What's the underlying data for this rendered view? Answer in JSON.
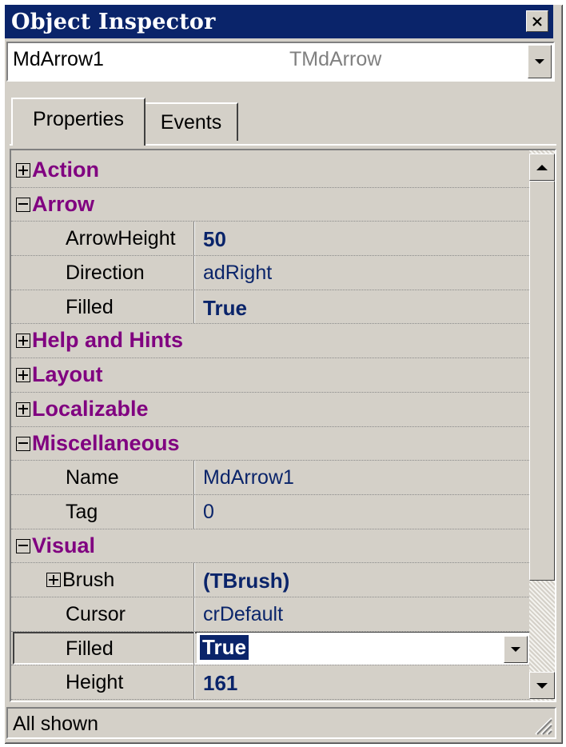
{
  "window": {
    "title": "Object Inspector",
    "close_icon": "close-icon"
  },
  "object_selector": {
    "name": "MdArrow1",
    "class_name": "TMdArrow"
  },
  "tabs": [
    {
      "label": "Properties",
      "active": true
    },
    {
      "label": "Events",
      "active": false
    }
  ],
  "property_rows": [
    {
      "kind": "category",
      "label": "Action",
      "expanded": false
    },
    {
      "kind": "category",
      "label": "Arrow",
      "expanded": true
    },
    {
      "kind": "property",
      "name": "ArrowHeight",
      "value": "50",
      "bold": true
    },
    {
      "kind": "property",
      "name": "Direction",
      "value": "adRight",
      "bold": false
    },
    {
      "kind": "property",
      "name": "Filled",
      "value": "True",
      "bold": true
    },
    {
      "kind": "category",
      "label": "Help and Hints",
      "expanded": false
    },
    {
      "kind": "category",
      "label": "Layout",
      "expanded": false
    },
    {
      "kind": "category",
      "label": "Localizable",
      "expanded": false
    },
    {
      "kind": "category",
      "label": "Miscellaneous",
      "expanded": true
    },
    {
      "kind": "property",
      "name": "Name",
      "value": "MdArrow1",
      "bold": false
    },
    {
      "kind": "property",
      "name": "Tag",
      "value": "0",
      "bold": false
    },
    {
      "kind": "category",
      "label": "Visual",
      "expanded": true
    },
    {
      "kind": "property",
      "name": "Brush",
      "value": "(TBrush)",
      "bold": true,
      "expandable": true
    },
    {
      "kind": "property",
      "name": "Cursor",
      "value": "crDefault",
      "bold": false
    },
    {
      "kind": "property",
      "name": "Filled",
      "value": "True",
      "bold": true,
      "selected": true
    },
    {
      "kind": "property",
      "name": "Height",
      "value": "161",
      "bold": true
    }
  ],
  "status": {
    "text": "All shown"
  },
  "colors": {
    "title_bar": "#0a246a",
    "category_text": "#800080",
    "value_text": "#0a246a",
    "face": "#d4d0c8"
  }
}
